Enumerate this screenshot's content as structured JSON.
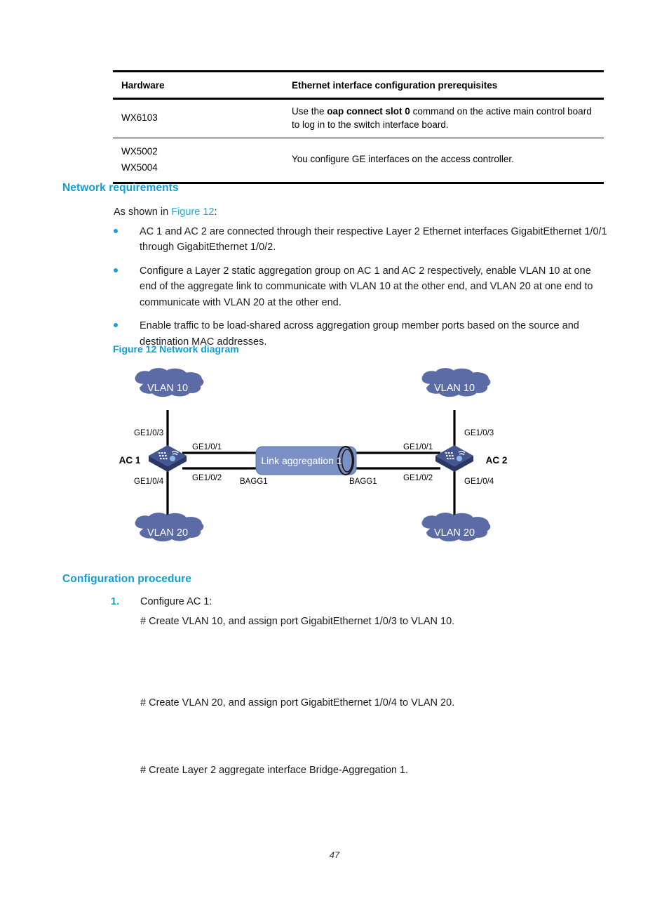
{
  "table": {
    "headers": [
      "Hardware",
      "Ethernet interface configuration prerequisites"
    ],
    "rows": [
      {
        "hardware": [
          "WX6103"
        ],
        "prereq_before": "Use the ",
        "prereq_bold": "oap connect slot 0",
        "prereq_after": " command on the active main control board to log in to the switch interface board."
      },
      {
        "hardware": [
          "WX5002",
          "WX5004"
        ],
        "prereq_before": "You configure GE interfaces on the access controller.",
        "prereq_bold": "",
        "prereq_after": ""
      }
    ]
  },
  "sections": {
    "network_requirements_heading": "Network requirements",
    "configuration_procedure_heading": "Configuration procedure"
  },
  "intro": {
    "prefix": "As shown in ",
    "xref": "Figure 12",
    "suffix": ":"
  },
  "requirements": [
    "AC 1 and AC 2 are connected through their respective Layer 2 Ethernet interfaces GigabitEthernet 1/0/1 through GigabitEthernet 1/0/2.",
    "Configure a Layer 2 static aggregation group on AC 1 and AC 2 respectively, enable VLAN 10 at one end of the aggregate link to communicate with VLAN 10 at the other end, and VLAN 20 at one end to communicate with VLAN 20 at the other end.",
    "Enable traffic to be load-shared across aggregation group member ports based on the source and destination MAC addresses."
  ],
  "figure": {
    "caption": "Figure 12 Network diagram",
    "colors": {
      "cloud_fill": "#5b6ba6",
      "cylinder_fill": "#7389bf",
      "device_top": "#3f4f8c",
      "device_side": "#2c3a6b",
      "link_line": "#000000",
      "label_text": "#000000"
    },
    "nodes": {
      "left_cloud_top": "VLAN 10",
      "left_cloud_bottom": "VLAN 20",
      "right_cloud_top": "VLAN 10",
      "right_cloud_bottom": "VLAN 20",
      "left_device": "AC 1",
      "right_device": "AC 2",
      "aggregation": "Link aggregation 1"
    },
    "labels": {
      "left_up": "GE1/0/3",
      "left_down": "GE1/0/4",
      "left_link_top": "GE1/0/1",
      "left_link_bottom": "GE1/0/2",
      "left_bagg": "BAGG1",
      "right_up": "GE1/0/3",
      "right_down": "GE1/0/4",
      "right_link_top": "GE1/0/1",
      "right_link_bottom": "GE1/0/2",
      "right_bagg": "BAGG1"
    }
  },
  "procedure": {
    "step1_number": "1.",
    "step1_label": "Configure AC 1:",
    "notes": [
      "# Create VLAN 10, and assign port GigabitEthernet 1/0/3 to VLAN 10.",
      "# Create VLAN 20, and assign port GigabitEthernet 1/0/4 to VLAN 20.",
      "# Create Layer 2 aggregate interface Bridge-Aggregation 1."
    ]
  },
  "page_number": "47"
}
